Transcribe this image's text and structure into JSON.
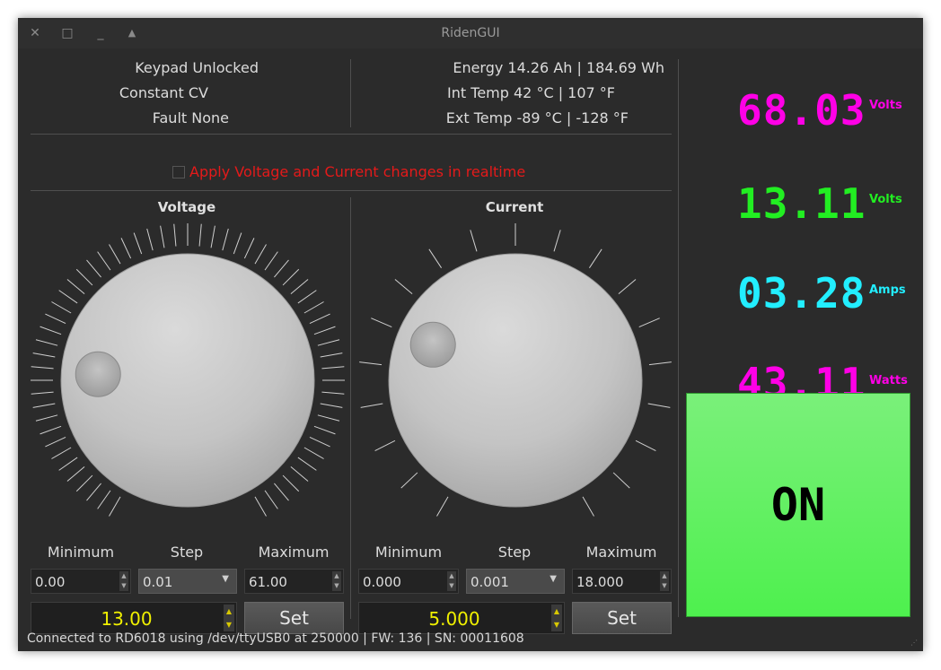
{
  "window": {
    "title": "RidenGUI"
  },
  "info": {
    "keypad": "Keypad Unlocked",
    "mode": "Constant CV",
    "fault": "Fault None",
    "energy": "Energy 14.26 Ah | 184.69 Wh",
    "int_temp": "Int Temp 42 °C | 107 °F",
    "ext_temp": "Ext Temp -89 °C | -128 °F"
  },
  "realtime_label": "Apply Voltage and Current changes in realtime",
  "voltage": {
    "title": "Voltage",
    "min_label": "Minimum",
    "step_label": "Step",
    "max_label": "Maximum",
    "min": "0.00",
    "step": "0.01",
    "max": "61.00",
    "set_value": "13.00",
    "set_label": "Set",
    "dial_level": 0.213
  },
  "current": {
    "title": "Current",
    "min_label": "Minimum",
    "step_label": "Step",
    "max_label": "Maximum",
    "min": "0.000",
    "step": "0.001",
    "max": "18.000",
    "set_value": "5.000",
    "set_label": "Set",
    "dial_level": 0.278
  },
  "readouts": {
    "v_set": {
      "value": "68.03",
      "unit": "Volts",
      "color": "#ff00e6"
    },
    "v_out": {
      "value": "13.11",
      "unit": "Volts",
      "color": "#22ee22"
    },
    "i_out": {
      "value": "03.28",
      "unit": "Amps",
      "color": "#22eeff"
    },
    "p_out": {
      "value": "43.11",
      "unit": "Watts",
      "color": "#ff00e6"
    }
  },
  "output_button": {
    "label": "ON",
    "color": "#5af05a"
  },
  "status": "Connected to RD6018 using /dev/ttyUSB0 at 250000 | FW: 136 | SN: 00011608",
  "icons": {
    "close": "close-icon",
    "maximize": "maximize-icon",
    "minimize": "minimize-icon",
    "shade": "shade-icon"
  }
}
